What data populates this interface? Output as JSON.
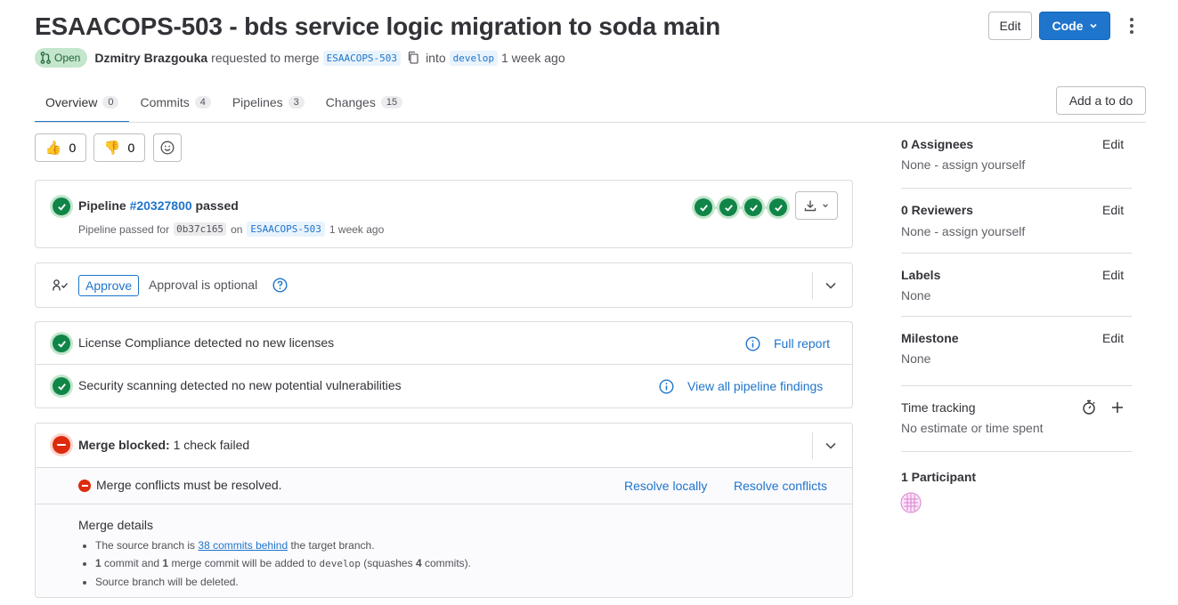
{
  "header": {
    "title": "ESAACOPS-503 - bds service logic migration to soda main",
    "edit_label": "Edit",
    "code_label": "Code",
    "status": "Open",
    "author": "Dzmitry Brazgouka",
    "requested_text": "requested to merge",
    "source_branch": "ESAACOPS-503",
    "into_text": "into",
    "target_branch": "develop",
    "time": "1 week ago"
  },
  "tabs": [
    {
      "label": "Overview",
      "count": "0"
    },
    {
      "label": "Commits",
      "count": "4"
    },
    {
      "label": "Pipelines",
      "count": "3"
    },
    {
      "label": "Changes",
      "count": "15"
    }
  ],
  "todo_label": "Add a to do",
  "reactions": {
    "thumbs_up": "0",
    "thumbs_down": "0"
  },
  "pipeline": {
    "prefix": "Pipeline",
    "id": "#20327800",
    "status": "passed",
    "sub_prefix": "Pipeline passed for",
    "commit": "0b37c165",
    "on": "on",
    "branch": "ESAACOPS-503",
    "time": "1 week ago"
  },
  "approval": {
    "button": "Approve",
    "text": "Approval is optional"
  },
  "license": {
    "text": "License Compliance detected no new licenses",
    "link": "Full report"
  },
  "security": {
    "text": "Security scanning detected no new potential vulnerabilities",
    "link": "View all pipeline findings"
  },
  "merge": {
    "blocked_bold": "Merge blocked:",
    "blocked_text": "1 check failed",
    "conflict_text": "Merge conflicts must be resolved.",
    "resolve_locally": "Resolve locally",
    "resolve_conflicts": "Resolve conflicts",
    "details_title": "Merge details",
    "d1_pre": "The source branch is",
    "d1_link": "38 commits behind",
    "d1_post": "the target branch.",
    "d2_n1": "1",
    "d2_a": "commit and",
    "d2_n2": "1",
    "d2_b": "merge commit will be added to",
    "d2_branch": "develop",
    "d2_c": "(squashes",
    "d2_n3": "4",
    "d2_d": "commits).",
    "d3": "Source branch will be deleted."
  },
  "sidebar": {
    "assignees_title": "0 Assignees",
    "assignees_value": "None - assign yourself",
    "reviewers_title": "0 Reviewers",
    "reviewers_value": "None - assign yourself",
    "labels_title": "Labels",
    "labels_value": "None",
    "milestone_title": "Milestone",
    "milestone_value": "None",
    "time_title": "Time tracking",
    "time_value": "No estimate or time spent",
    "participants_title": "1 Participant",
    "edit_label": "Edit"
  },
  "colors": {
    "accent": "#1f75cb",
    "success": "#108548",
    "danger": "#dd2b0e"
  }
}
